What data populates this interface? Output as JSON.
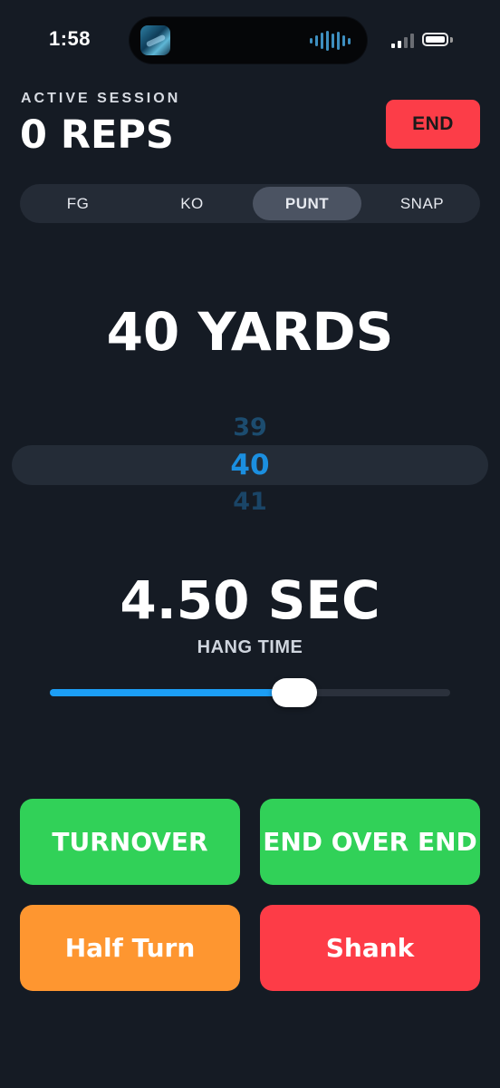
{
  "status_bar": {
    "time": "1:58"
  },
  "session": {
    "label": "ACTIVE SESSION",
    "reps": "0 REPS",
    "end_label": "END"
  },
  "tabs": [
    {
      "label": "FG",
      "active": false
    },
    {
      "label": "KO",
      "active": false
    },
    {
      "label": "PUNT",
      "active": true
    },
    {
      "label": "SNAP",
      "active": false
    }
  ],
  "distance": {
    "display": "40 YARDS",
    "picker_prev": "39",
    "picker_current": "40",
    "picker_next": "41"
  },
  "hang_time": {
    "value": "4.50 SEC",
    "label": "HANG TIME",
    "slider_fraction": 0.6
  },
  "actions": [
    {
      "label": "TURNOVER",
      "color": "#31d158"
    },
    {
      "label": "END OVER END",
      "color": "#31d158"
    },
    {
      "label": "Half Turn",
      "color": "#fe9630"
    },
    {
      "label": "Shank",
      "color": "#fd3c47"
    }
  ],
  "colors": {
    "background": "#151b24",
    "accent_blue": "#1c9ef5",
    "end_red": "#fc3d48"
  }
}
